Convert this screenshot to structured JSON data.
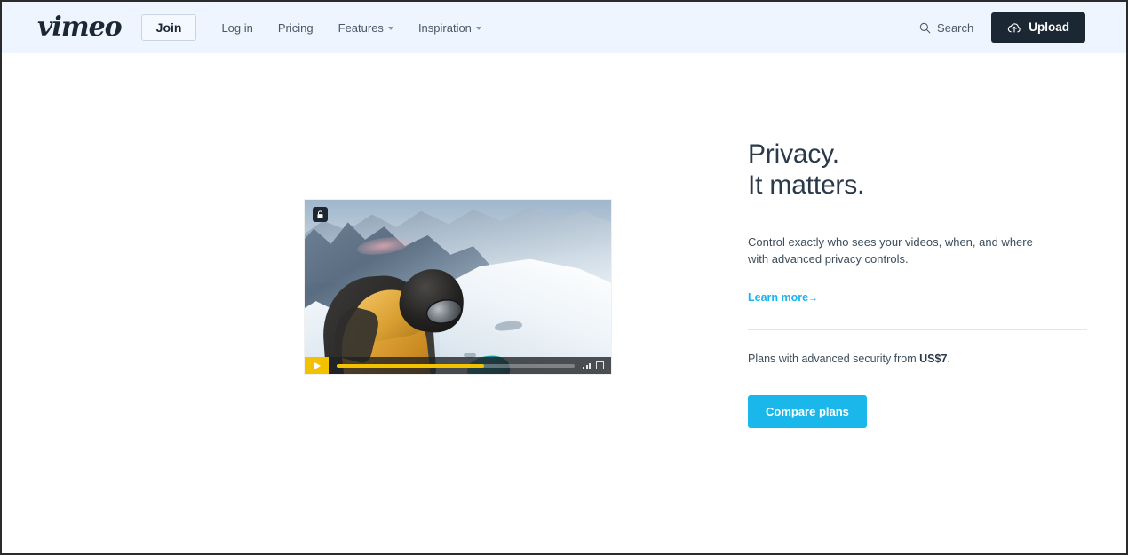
{
  "header": {
    "logo_text": "vimeo",
    "join_label": "Join",
    "nav": [
      {
        "label": "Log in",
        "has_caret": false
      },
      {
        "label": "Pricing",
        "has_caret": false
      },
      {
        "label": "Features",
        "has_caret": true
      },
      {
        "label": "Inspiration",
        "has_caret": true
      }
    ],
    "search_label": "Search",
    "upload_label": "Upload",
    "background_color": "#eef5ff",
    "upload_bg_color": "#1b2733"
  },
  "player": {
    "lock_icon": "lock-icon",
    "play_icon": "play-icon",
    "quality_icon": "signal-bars-icon",
    "fullscreen_icon": "fullscreen-icon",
    "progress_percent": "62",
    "accent_color": "#f2c200"
  },
  "panel": {
    "headline_line1": "Privacy.",
    "headline_line2": "It matters.",
    "body": "Control exactly who sees your videos, when, and where with advanced privacy controls.",
    "learn_more_label": "Learn more",
    "learn_more_arrow": "→",
    "plans_prefix": "Plans with advanced security from ",
    "plans_price": "US$7",
    "plans_suffix": ".",
    "compare_label": "Compare plans",
    "link_color": "#19b4ec",
    "button_color": "#1ab7ea"
  }
}
